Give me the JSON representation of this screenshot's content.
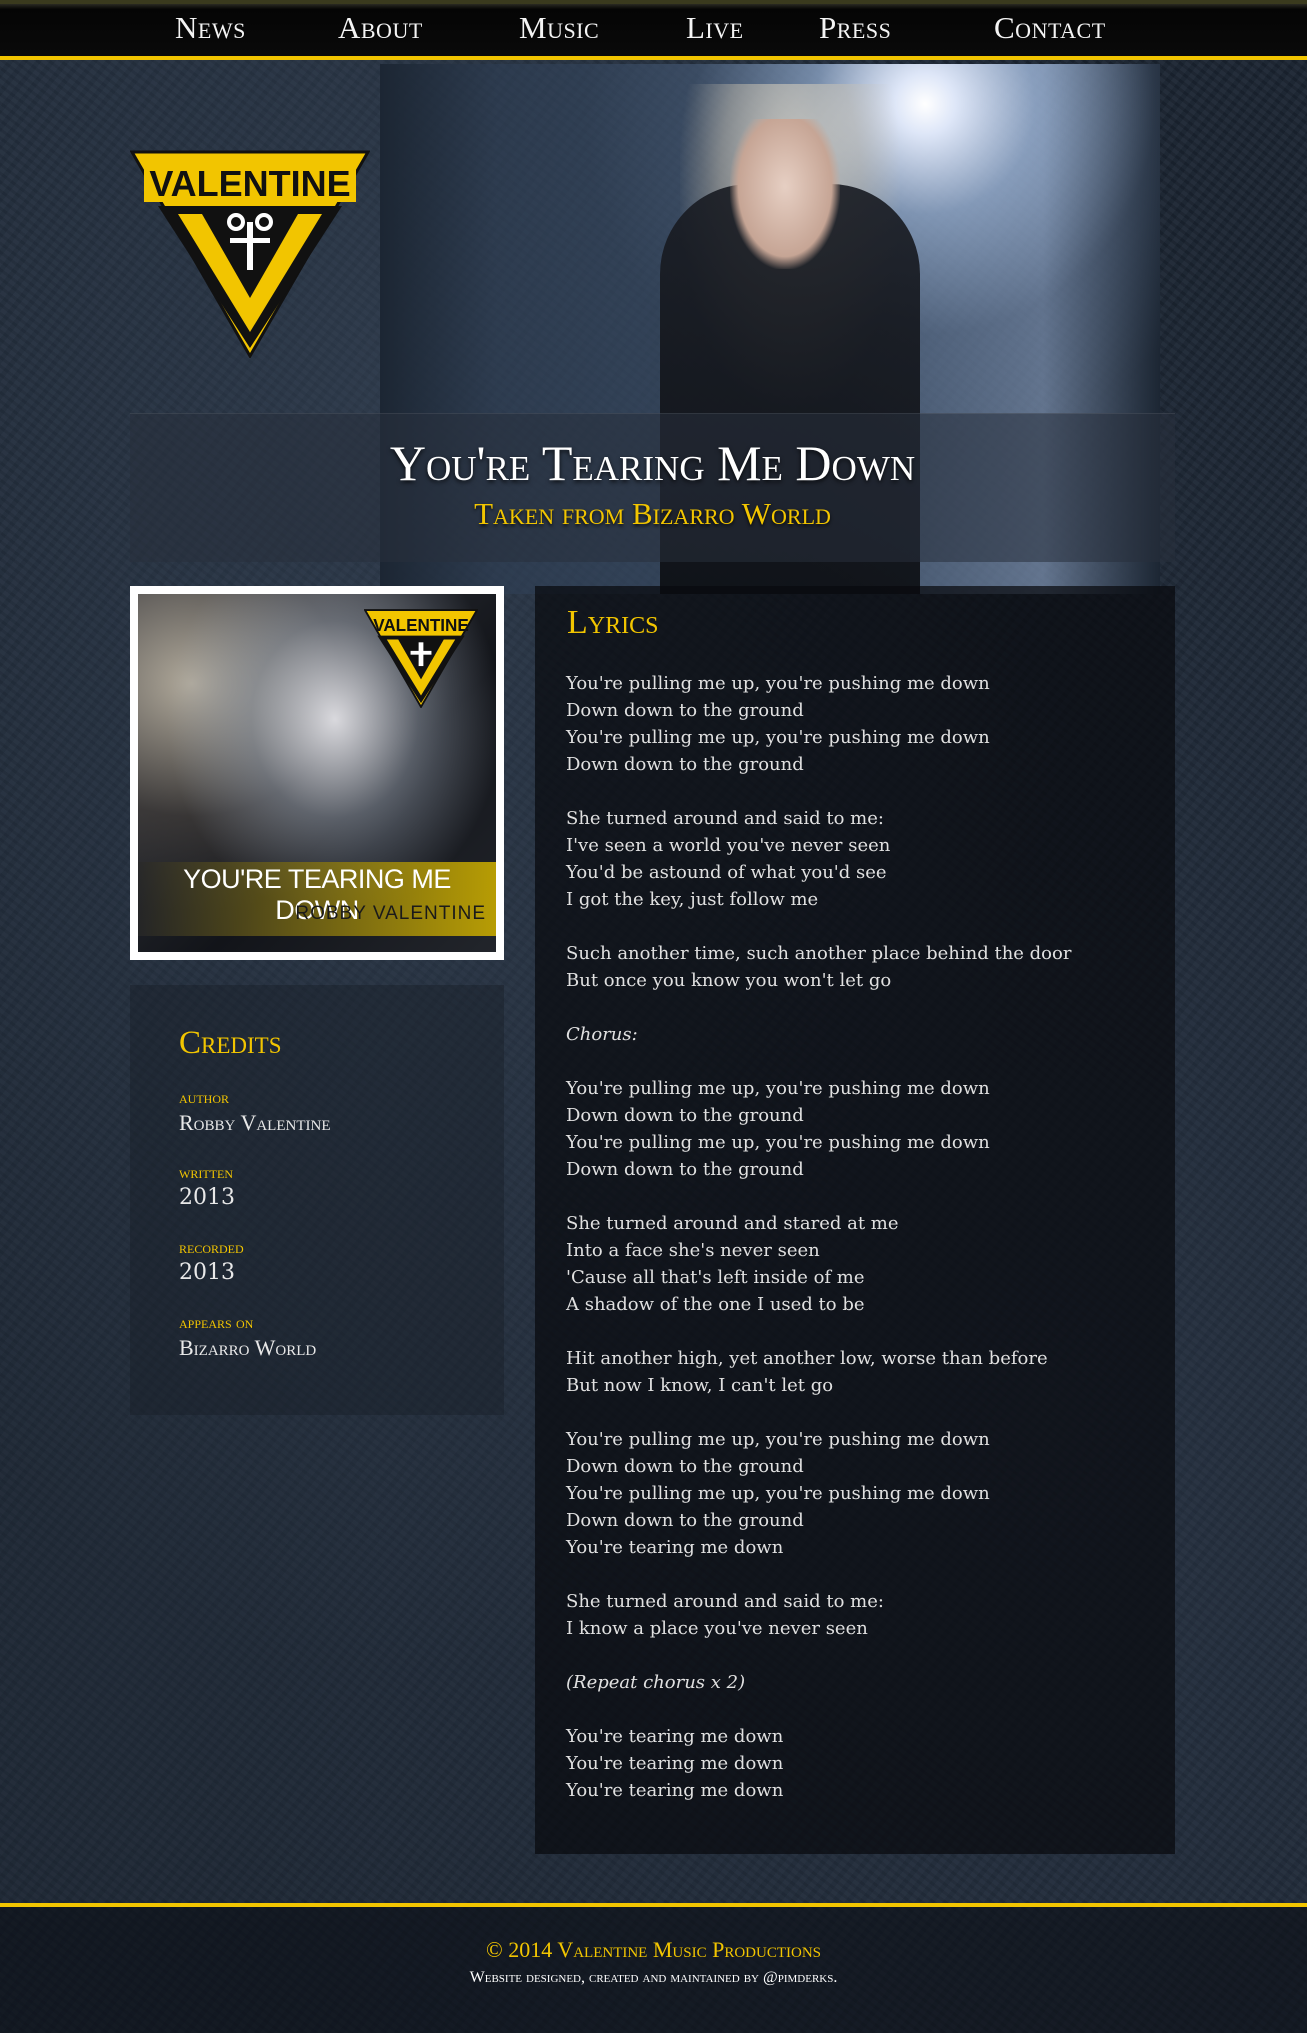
{
  "nav": {
    "items": [
      "News",
      "About",
      "Music",
      "Live",
      "Press",
      "Contact"
    ]
  },
  "brand": {
    "logo_text": "VALENTINE",
    "accent": "#f2c500"
  },
  "song": {
    "title": "You're Tearing Me Down",
    "subtitle": "Taken from Bizarro World"
  },
  "cover": {
    "title": "YOU'RE TEARING ME DOWN",
    "artist": "ROBBY VALENTINE",
    "logo_text": "VALENTINE"
  },
  "credits": {
    "heading": "Credits",
    "items": [
      {
        "label": "author",
        "value": "Robby Valentine"
      },
      {
        "label": "written",
        "value": "2013"
      },
      {
        "label": "recorded",
        "value": "2013"
      },
      {
        "label": "appears on",
        "value": "Bizarro World"
      }
    ]
  },
  "lyrics": {
    "heading": "Lyrics",
    "stanzas": [
      [
        "You're pulling me up, you're pushing me down",
        "Down down to the ground",
        "You're pulling me up, you're pushing me down",
        "Down down to the ground"
      ],
      [
        "She turned around and said to me:",
        "I've seen a world you've never seen",
        "You'd be astound of what you'd see",
        "I got the key, just follow me"
      ],
      [
        "Such another time, such another place behind the door",
        "But once you know you won't let go"
      ],
      [
        "Chorus:"
      ],
      [
        "You're pulling me up, you're pushing me down",
        "Down down to the ground",
        "You're pulling me up, you're pushing me down",
        "Down down to the ground"
      ],
      [
        "She turned around and stared at me",
        "Into a face she's never seen",
        "'Cause all that's left inside of me",
        "A shadow of the one I used to be"
      ],
      [
        "Hit another high, yet another low, worse than before",
        "But now I know, I can't let go"
      ],
      [
        "You're pulling me up, you're pushing me down",
        "Down down to the ground",
        "You're pulling me up, you're pushing me down",
        "Down down to the ground",
        "You're tearing me down"
      ],
      [
        "She turned around and said to me:",
        "I know a place you've never seen"
      ],
      [
        "(Repeat chorus x 2)"
      ],
      [
        "You're tearing me down",
        "You're tearing me down",
        "You're tearing me down"
      ]
    ],
    "italic_lines": [
      "Chorus:",
      "(Repeat chorus x 2)"
    ]
  },
  "footer": {
    "copyright": "© 2014 Valentine Music Productions",
    "credit": "Website designed, created and maintained by @pimderks."
  }
}
